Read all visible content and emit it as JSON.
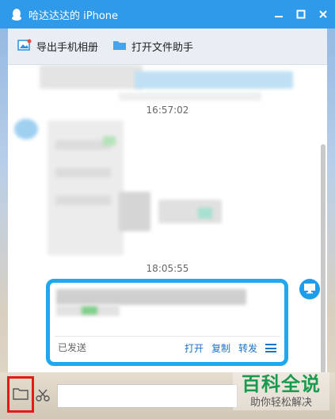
{
  "window": {
    "title": "哈达达达的 iPhone",
    "controls": [
      "minimize-icon",
      "maximize-icon",
      "close-icon"
    ]
  },
  "toolbar": {
    "items": [
      {
        "label": "导出手机相册",
        "icon": "photo-export-icon"
      },
      {
        "label": "打开文件助手",
        "icon": "folder-icon"
      }
    ]
  },
  "chat": {
    "timestamps": [
      "16:57:02",
      "18:05:55"
    ],
    "sent_card": {
      "status": "已发送",
      "actions": [
        "打开",
        "复制",
        "转发"
      ],
      "menu_icon": "menu-icon"
    }
  },
  "inputbar": {
    "folder_icon": "folder-icon",
    "scissors_icon": "scissors-icon",
    "input_value": ""
  },
  "watermark": {
    "main": "百科全说",
    "sub": "助你轻松解决"
  },
  "colors": {
    "titlebar": "#2f9ae9",
    "card_border": "#1fa8f0",
    "action_link": "#1a73c7",
    "highlight_box": "#e3191a",
    "watermark_green": "#1a9a4e"
  }
}
